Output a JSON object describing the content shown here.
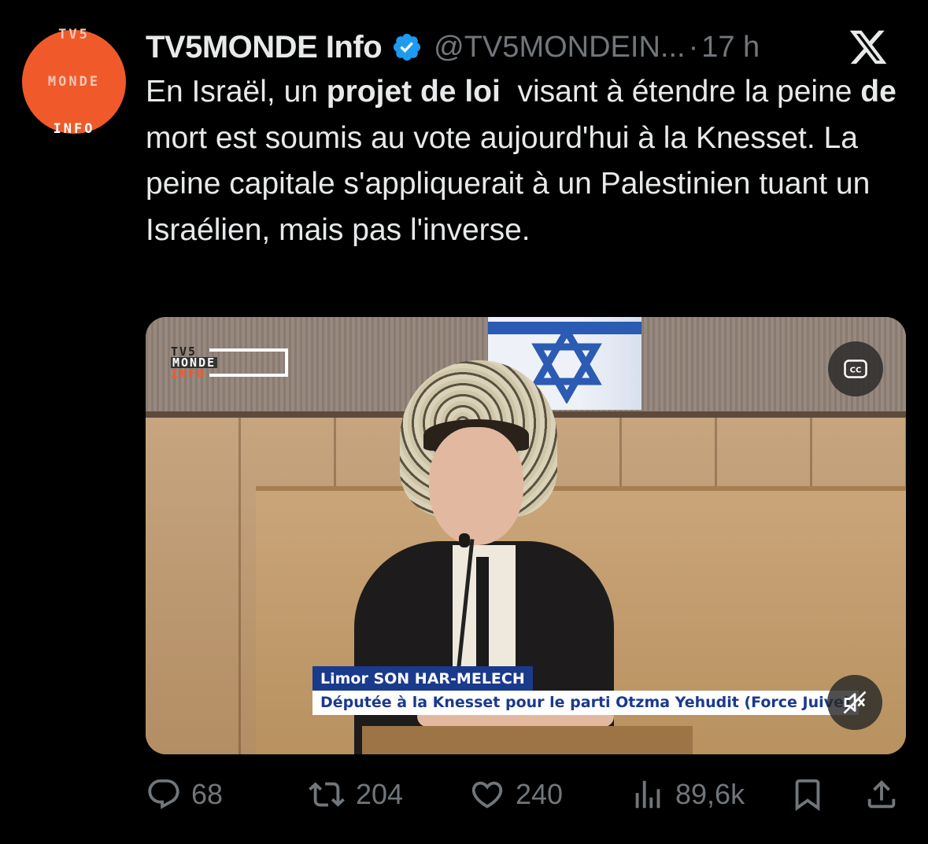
{
  "author": {
    "avatar_lines": [
      "TV5",
      "MONDE",
      "INFO"
    ],
    "display_name": "TV5MONDE Info",
    "handle": "@TV5MONDEIN...",
    "separator": "·",
    "time": "17 h"
  },
  "tweet": {
    "segments": [
      {
        "text": "En Israël, un ",
        "bold": false
      },
      {
        "text": "projet de loi",
        "bold": true
      },
      {
        "text": "  visant à étendre la peine ",
        "bold": false
      },
      {
        "text": "de",
        "bold": true
      },
      {
        "text": " mort est soumis au vote aujourd'hui à la Knesset. La peine capitale s'appliquerait à un Palestinien tuant un Israélien, mais pas l'inverse.",
        "bold": false
      }
    ]
  },
  "media": {
    "logo_lines": [
      "TV5",
      "MONDE",
      "INFO"
    ],
    "lower_third_name": "Limor SON HAR-MELECH",
    "lower_third_role": "Députée à la Knesset pour le parti Otzma Yehudit (Force Juive)",
    "cc_label": "CC"
  },
  "actions": {
    "replies": "68",
    "reposts": "204",
    "likes": "240",
    "views": "89,6k"
  },
  "colors": {
    "background": "#000000",
    "text": "#e7e9ea",
    "muted": "#71767b",
    "verified": "#1d9bf0",
    "avatar": "#f05a2b",
    "lower_third_blue": "#1a3a8c"
  },
  "icons": [
    "x-logo-icon",
    "verified-badge-icon",
    "closed-captions-icon",
    "muted-speaker-icon",
    "reply-icon",
    "repost-icon",
    "like-icon",
    "views-icon",
    "bookmark-icon",
    "share-icon"
  ]
}
